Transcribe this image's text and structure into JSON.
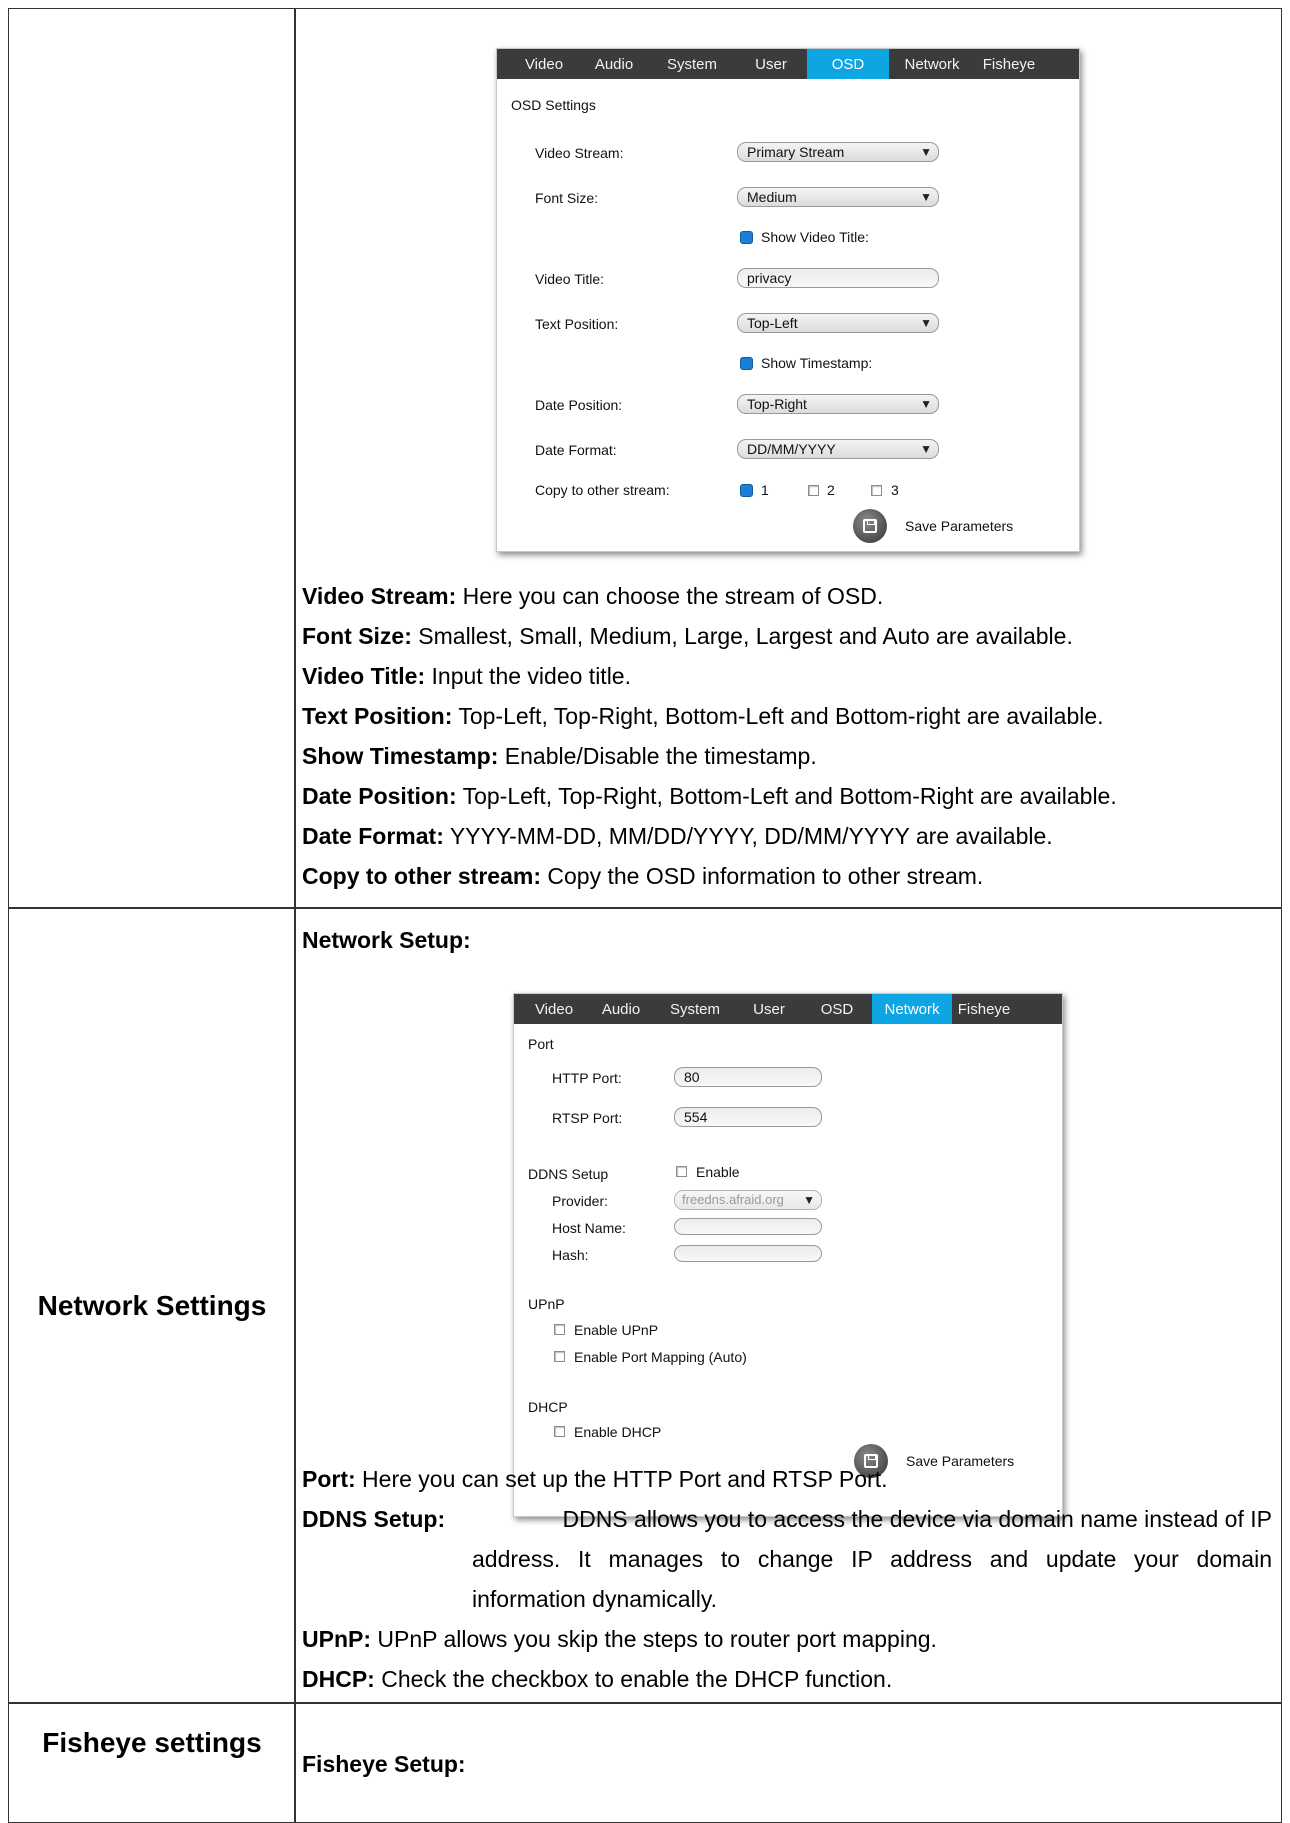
{
  "rows": [
    {
      "label": ""
    },
    {
      "label": "Network Settings"
    },
    {
      "label": "Fisheye settings"
    }
  ],
  "tabs": [
    "Video",
    "Audio",
    "System",
    "User",
    "OSD",
    "Network",
    "Fisheye"
  ],
  "osd_panel": {
    "active_tab": "OSD",
    "heading": "OSD Settings",
    "video_stream_label": "Video Stream:",
    "video_stream_value": "Primary Stream",
    "font_size_label": "Font Size:",
    "font_size_value": "Medium",
    "show_video_title_label": "Show Video Title:",
    "video_title_label": "Video Title:",
    "video_title_value": "privacy",
    "text_position_label": "Text Position:",
    "text_position_value": "Top-Left",
    "show_timestamp_label": "Show Timestamp:",
    "date_position_label": "Date Position:",
    "date_position_value": "Top-Right",
    "date_format_label": "Date Format:",
    "date_format_value": "DD/MM/YYYY",
    "copy_label": "Copy to other stream:",
    "copy_options": [
      "1",
      "2",
      "3"
    ],
    "save_label": "Save Parameters"
  },
  "osd_desc": [
    {
      "term": "Video Stream:",
      "text": " Here you can choose the stream of OSD."
    },
    {
      "term": "Font Size:",
      "text": " Smallest, Small, Medium, Large, Largest and Auto are available."
    },
    {
      "term": "Video Title:",
      "text": " Input the video title."
    },
    {
      "term": "Text Position:",
      "text": " Top-Left, Top-Right, Bottom-Left and Bottom-right are available."
    },
    {
      "term": "Show Timestamp:",
      "text": " Enable/Disable the timestamp."
    },
    {
      "term": "Date Position:",
      "text": " Top-Left, Top-Right, Bottom-Left and Bottom-Right are available."
    },
    {
      "term": "Date Format:",
      "text": " YYYY-MM-DD, MM/DD/YYYY, DD/MM/YYYY are available."
    },
    {
      "term": "Copy to other stream:",
      "text": " Copy the OSD information to other stream."
    }
  ],
  "network_heading": "Network Setup:",
  "network_panel": {
    "active_tab": "Network",
    "port_heading": "Port",
    "http_label": "HTTP Port:",
    "http_value": "80",
    "rtsp_label": "RTSP Port:",
    "rtsp_value": "554",
    "ddns_label": "DDNS Setup",
    "ddns_enable_label": "Enable",
    "provider_label": "Provider:",
    "provider_value": "freedns.afraid.org",
    "host_label": "Host Name:",
    "hash_label": "Hash:",
    "upnp_heading": "UPnP",
    "enable_upnp_label": "Enable UPnP",
    "enable_port_mapping_label": "Enable Port Mapping (Auto)",
    "dhcp_heading": "DHCP",
    "enable_dhcp_label": "Enable DHCP",
    "save_label": "Save Parameters"
  },
  "network_desc": {
    "port_term": "Port:",
    "port_text": " Here you can set up the HTTP Port and RTSP Port.",
    "ddns_term": "DDNS Setup:",
    "ddns_line1": " DDNS allows you to access the device via domain name instead of IP",
    "ddns_line2": "address. It manages to change IP address and update your domain",
    "ddns_line3": "information dynamically.",
    "upnp_term": "UPnP:",
    "upnp_text": " UPnP allows you skip the steps to router port mapping.",
    "dhcp_term": "DHCP:",
    "dhcp_text": " Check the checkbox to enable the DHCP function."
  },
  "fisheye_heading": "Fisheye Setup:"
}
